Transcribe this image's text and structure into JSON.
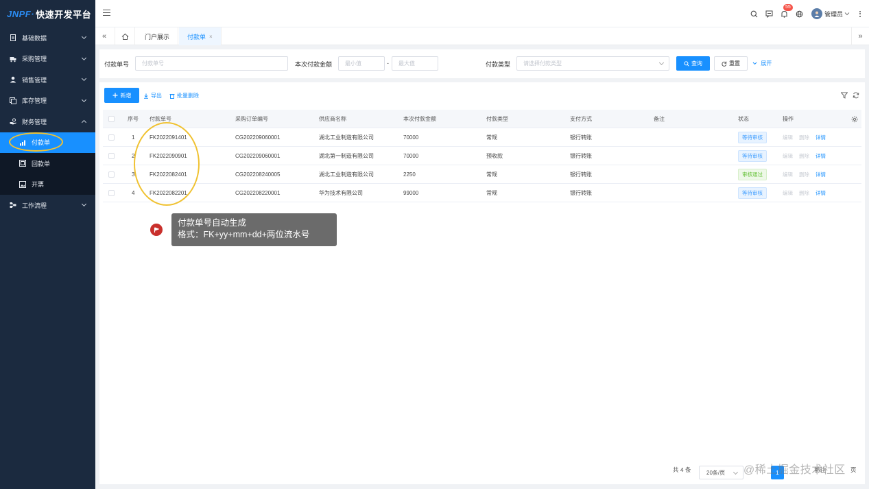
{
  "app": {
    "logo_mark": "JNPF",
    "logo_dot": "·",
    "logo_text": "快速开发平台"
  },
  "sidebar": {
    "items": [
      {
        "label": "基础数据",
        "icon": "document-icon"
      },
      {
        "label": "采购管理",
        "icon": "truck-icon"
      },
      {
        "label": "销售管理",
        "icon": "user-icon"
      },
      {
        "label": "库存管理",
        "icon": "copy-icon"
      },
      {
        "label": "财务管理",
        "icon": "hand-coin-icon"
      }
    ],
    "sub_items": [
      {
        "label": "付款单",
        "icon": "bar-chart-icon"
      },
      {
        "label": "回款单",
        "icon": "receipt-icon"
      },
      {
        "label": "开票",
        "icon": "image-icon"
      }
    ],
    "after": {
      "label": "工作流程",
      "icon": "flow-icon"
    }
  },
  "header": {
    "notification_count": "55",
    "username": "管理员"
  },
  "tabs": {
    "home_tab": "门户展示",
    "active_tab": "付款单",
    "close_glyph": "×"
  },
  "search": {
    "payment_no_label": "付款单号",
    "payment_no_placeholder": "付款单号",
    "amount_label": "本次付款金额",
    "min_placeholder": "最小值",
    "range_sep": "-",
    "max_placeholder": "最大值",
    "type_label": "付款类型",
    "type_placeholder": "请选择付款类型",
    "query_btn": "查询",
    "reset_btn": "重置",
    "expand_link": "展开"
  },
  "toolbar": {
    "add": "新增",
    "export": "导出",
    "batch_delete": "批量删除"
  },
  "table": {
    "columns": [
      "序号",
      "付款单号",
      "采购订单编号",
      "供应商名称",
      "本次付款金额",
      "付款类型",
      "支付方式",
      "备注",
      "状态",
      "操作"
    ],
    "rows": [
      {
        "idx": "1",
        "no": "FK2022091401",
        "po": "CG202209060001",
        "supplier": "湖北工业制造有限公司",
        "amount": "70000",
        "type": "常规",
        "pay": "银行转账",
        "note": "",
        "status": "等待审核",
        "status_kind": "wait"
      },
      {
        "idx": "2",
        "no": "FK2022090901",
        "po": "CG202209060001",
        "supplier": "湖北第一制造有限公司",
        "amount": "70000",
        "type": "预收款",
        "pay": "银行转账",
        "note": "",
        "status": "等待审核",
        "status_kind": "wait"
      },
      {
        "idx": "3",
        "no": "FK2022082401",
        "po": "CG202208240005",
        "supplier": "湖北工业制造有限公司",
        "amount": "2250",
        "type": "常规",
        "pay": "银行转账",
        "note": "",
        "status": "审核通过",
        "status_kind": "pass"
      },
      {
        "idx": "4",
        "no": "FK2022082201",
        "po": "CG202208220001",
        "supplier": "华为技术有限公司",
        "amount": "99000",
        "type": "常规",
        "pay": "银行转账",
        "note": "",
        "status": "等待审核",
        "status_kind": "wait"
      }
    ],
    "ops": [
      "编辑",
      "删除",
      "详情"
    ]
  },
  "tip": {
    "line1": "付款单号自动生成",
    "line2": "格式：FK+yy+mm+dd+两位流水号"
  },
  "pagination": {
    "total": "共 4 条",
    "page_size": "20条/页",
    "current": "1",
    "goto": "前往",
    "page_unit": "页"
  },
  "watermark": "@稀土掘金技术社区",
  "colors": {
    "accent": "#1890ff",
    "sidebar_bg": "#1b2a3f",
    "highlight": "#f0c232"
  }
}
